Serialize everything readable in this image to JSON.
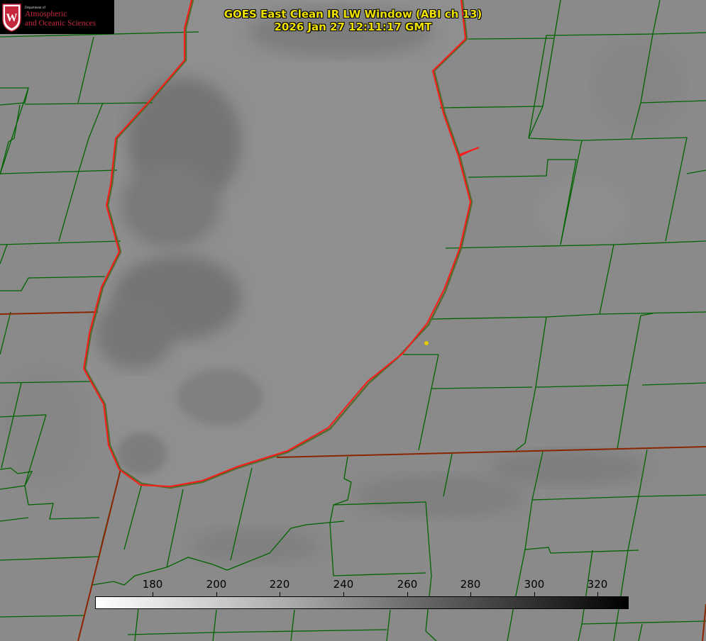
{
  "logo": {
    "department": "Department of",
    "line1": "Atmospheric",
    "line2": "and Oceanic Sciences",
    "seal_letter": "W"
  },
  "title": {
    "line1": "GOES East Clean IR LW Window (ABI ch 13)",
    "line2": "2026 Jan 27 12:11:17 GMT"
  },
  "colorbar": {
    "ticks": [
      "180",
      "200",
      "220",
      "240",
      "260",
      "280",
      "300",
      "320"
    ]
  },
  "colors": {
    "background": "#8a8a8a",
    "lake": "#8f8f8f",
    "cloud_dark": "#6e6e6e",
    "county_lines": "#006400",
    "state_lines": "#8b2500",
    "shoreline": "#ff1a1a",
    "title_text": "#f0e200",
    "marker": "#e6c800"
  }
}
